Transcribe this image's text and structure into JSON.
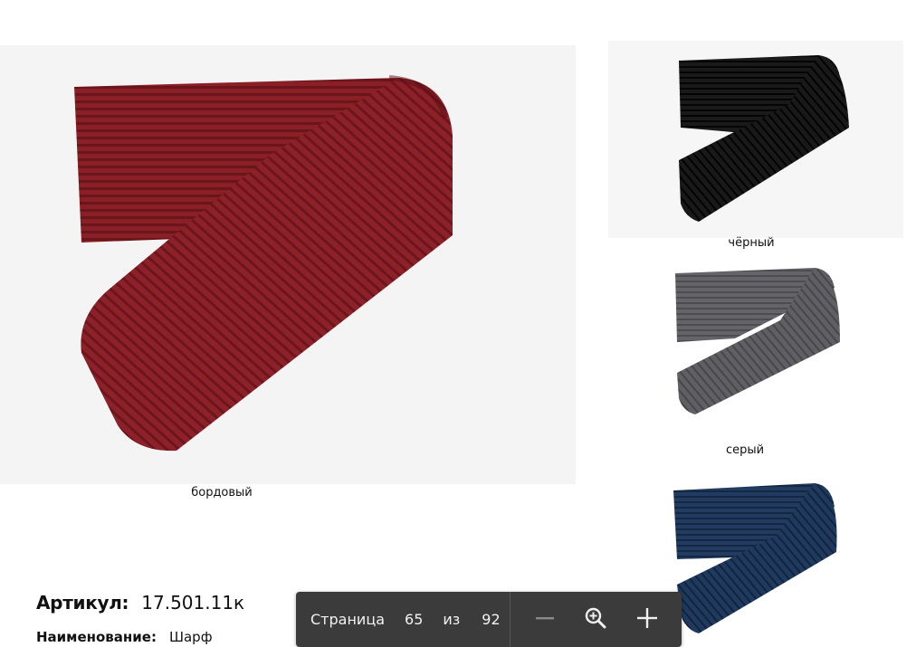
{
  "products": {
    "main": {
      "color_name": "бордовый",
      "color": "#8a1f26"
    },
    "variants": [
      {
        "color_name": "чёрный",
        "color": "#141414"
      },
      {
        "color_name": "серый",
        "color": "#5f5f63"
      },
      {
        "color_name": "",
        "color": "#1d3556"
      }
    ]
  },
  "specs": {
    "article_label": "Артикул:",
    "article_value": "17.501.11к",
    "name_label": "Наименование:",
    "name_value": "Шарф"
  },
  "viewer_toolbar": {
    "page_label": "Страница",
    "current_page": "65",
    "of_label": "из",
    "total_pages": "92",
    "zoom_out_icon": "minus-icon",
    "zoom_reset_icon": "magnifier-plus-icon",
    "zoom_in_icon": "plus-icon"
  }
}
